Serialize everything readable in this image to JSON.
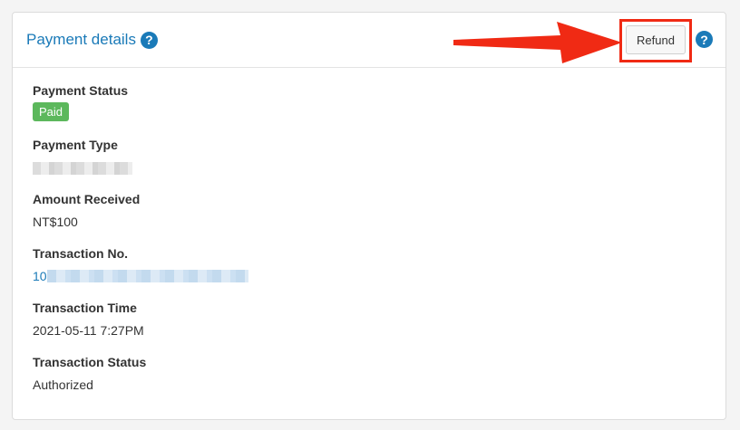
{
  "header": {
    "title": "Payment details",
    "refund_label": "Refund",
    "help_icon": "question-circle-icon"
  },
  "annotation": {
    "arrow_color": "#f02a14",
    "highlight_color": "#f02a14"
  },
  "fields": {
    "payment_status": {
      "label": "Payment Status",
      "value": "Paid"
    },
    "payment_type": {
      "label": "Payment Type",
      "value": ""
    },
    "amount_received": {
      "label": "Amount Received",
      "value": "NT$100"
    },
    "transaction_no": {
      "label": "Transaction No.",
      "value_prefix": "10"
    },
    "transaction_time": {
      "label": "Transaction Time",
      "value": "2021-05-11 7:27PM"
    },
    "transaction_status": {
      "label": "Transaction Status",
      "value": "Authorized"
    }
  },
  "colors": {
    "accent": "#1a7ab8",
    "status_paid": "#5cb85c"
  }
}
